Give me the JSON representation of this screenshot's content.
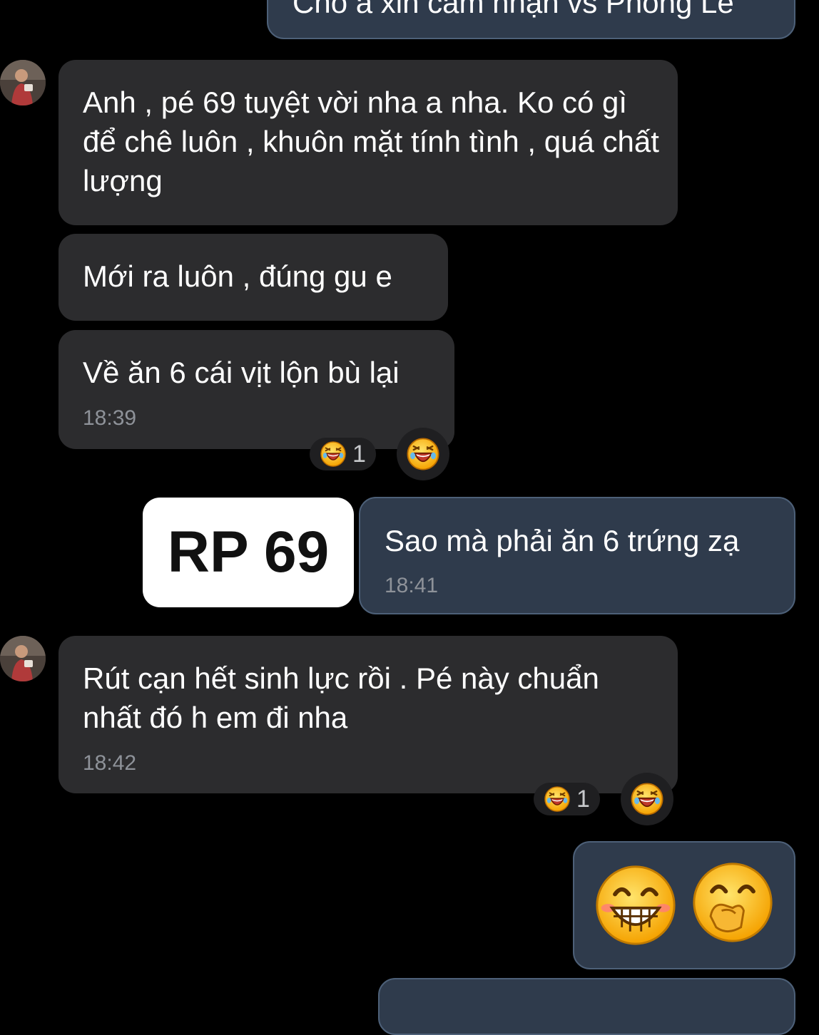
{
  "top_cut_message": {
    "text": "Cho a xin cảm nhận vs Phong Le"
  },
  "messages": [
    {
      "text": "Anh , pé 69 tuyệt vời nha a nha. Ko có gì để chê luôn , khuôn mặt tính tình , quá chất lượng"
    },
    {
      "text": "Mới ra luôn , đúng gu e"
    },
    {
      "text": "Về ăn 6 cái vịt lộn bù lại",
      "time": "18:39",
      "reaction_count": "1"
    },
    {
      "text": "Sao mà phải ăn 6 trứng zạ",
      "time": "18:41"
    },
    {
      "text": "Rút cạn hết sinh lực rồi . Pé này chuẩn nhất đó h em đi nha",
      "time": "18:42",
      "reaction_count": "1"
    }
  ],
  "badge": {
    "label": "RP 69"
  },
  "sticker_message": {
    "emojis": [
      "grinning-blush-face",
      "giggling-face"
    ]
  },
  "colors": {
    "incoming_bubble": "#2c2c2e",
    "outgoing_bubble": "#2f3b4c",
    "outgoing_border": "#4d6078",
    "timestamp": "#8e9299",
    "reaction_bg": "#1f1f21"
  }
}
